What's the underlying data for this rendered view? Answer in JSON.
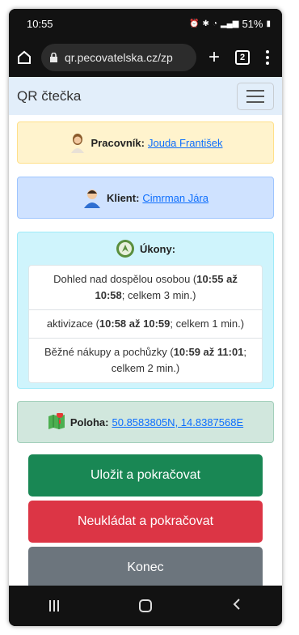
{
  "status": {
    "time": "10:55",
    "battery": "51%"
  },
  "browser": {
    "url": "qr.pecovatelska.cz/zp",
    "tab_count": "2"
  },
  "app": {
    "brand": "QR čtečka"
  },
  "worker": {
    "label": "Pracovník:",
    "name": "Jouda František"
  },
  "client": {
    "label": "Klient:",
    "name": "Cimrman Jára"
  },
  "tasks": {
    "label": "Úkony:",
    "items": [
      {
        "name": "Dohled nad dospělou osobou",
        "time": "10:55 až 10:58",
        "total": "; celkem 3 min."
      },
      {
        "name": "aktivizace",
        "time": "10:58 až 10:59",
        "total": "; celkem 1 min."
      },
      {
        "name": "Běžné nákupy a pochůzky",
        "time": "10:59 až 11:01",
        "total": "; celkem 2 min."
      }
    ]
  },
  "location": {
    "label": "Poloha:",
    "coords": "50.8583805N, 14.8387568E"
  },
  "buttons": {
    "save": "Uložit a pokračovat",
    "nosave": "Neukládat a pokračovat",
    "end": "Konec"
  },
  "colors": {
    "save": "#198754",
    "nosave": "#dc3545",
    "end": "#6c757d",
    "link": "#0d6efd"
  },
  "icons": [
    "home-icon",
    "lock-icon",
    "plus-icon",
    "tabs-icon",
    "more-icon",
    "hamburger-icon",
    "worker-avatar-icon",
    "client-avatar-icon",
    "compass-icon",
    "map-icon",
    "recent-apps-icon",
    "home-nav-icon",
    "back-icon"
  ]
}
